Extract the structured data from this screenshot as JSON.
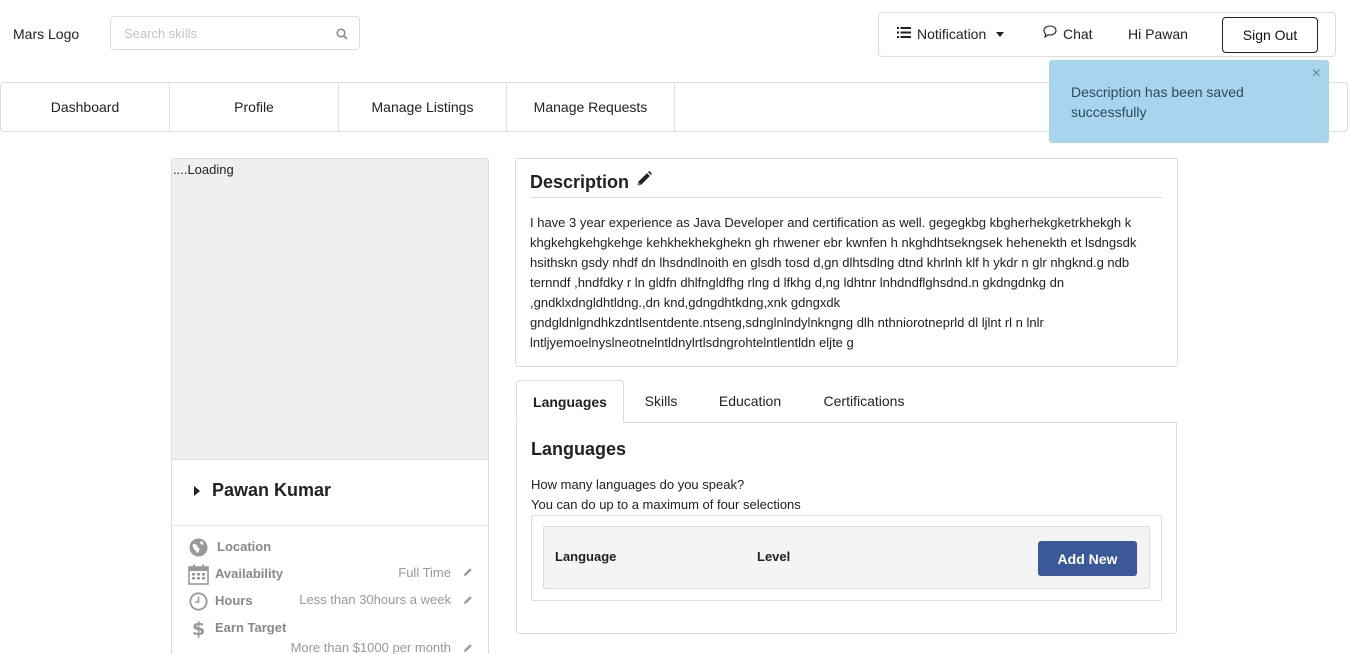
{
  "header": {
    "logo_text": "Mars Logo",
    "search": {
      "placeholder": "Search skills",
      "icon": "search-icon"
    },
    "notification_label": "Notification",
    "chat_label": "Chat",
    "greeting": "Hi Pawan",
    "signout_label": "Sign Out"
  },
  "nav": {
    "items": [
      {
        "label": "Dashboard"
      },
      {
        "label": "Profile"
      },
      {
        "label": "Manage Listings"
      },
      {
        "label": "Manage Requests"
      }
    ]
  },
  "toast": {
    "message": "Description has been saved successfully",
    "close": "×",
    "color": "#a8d4ee"
  },
  "profile": {
    "image_status": "....Loading",
    "name": "Pawan Kumar",
    "info": [
      {
        "label": "Location",
        "value": "",
        "icon": "globe-icon"
      },
      {
        "label": "Availability",
        "value": "Full Time",
        "icon": "calendar-icon"
      },
      {
        "label": "Hours",
        "value": "Less than 30hours a week",
        "icon": "clock-icon"
      },
      {
        "label": "Earn Target",
        "value": "More than $1000 per month",
        "icon": "dollar-icon"
      }
    ]
  },
  "description": {
    "title": "Description",
    "text": "I have 3 year experience as Java Developer and certification as well. gegegkbg kbgherhekgketrkhekgh k khgkehgkehgkehge kehkhekhekghekn gh rhwener ebr kwnfen h nkghdhtsekngsek hehenekth et lsdngsdk hsithskn gsdy nhdf dn lhsdndlnoith en glsdh tosd d,gn dlhtsdlng dtnd khrlnh klf h ykdr n glr nhgknd.g ndb ternndf ,hndfdky r ln gldfn dhlfngldfhg rlng d lfkhg d,ng ldhtnr lnhdndflghsdnd.n gkdngdnkg dn ,gndklxdngldhtldng.,dn knd,gdngdhtkdng,xnk gdngxdk gndgldnlgndhkzdntlsentdente.ntseng,sdnglnlndylnkngng dlh nthniorotneprld dl ljlnt rl n lnlr lntljyemoelnyslneotnelntldnylrtlsdngrohtelntlentldn eljte g"
  },
  "tabs": {
    "items": [
      {
        "label": "Languages"
      },
      {
        "label": "Skills"
      },
      {
        "label": "Education"
      },
      {
        "label": "Certifications"
      }
    ],
    "active": "Languages"
  },
  "languages": {
    "title": "Languages",
    "question": "How many languages do you speak?",
    "hint": "You can do up to a maximum of four selections",
    "col_language": "Language",
    "col_level": "Level",
    "add_new_label": "Add New",
    "button_color": "#3b5998"
  }
}
